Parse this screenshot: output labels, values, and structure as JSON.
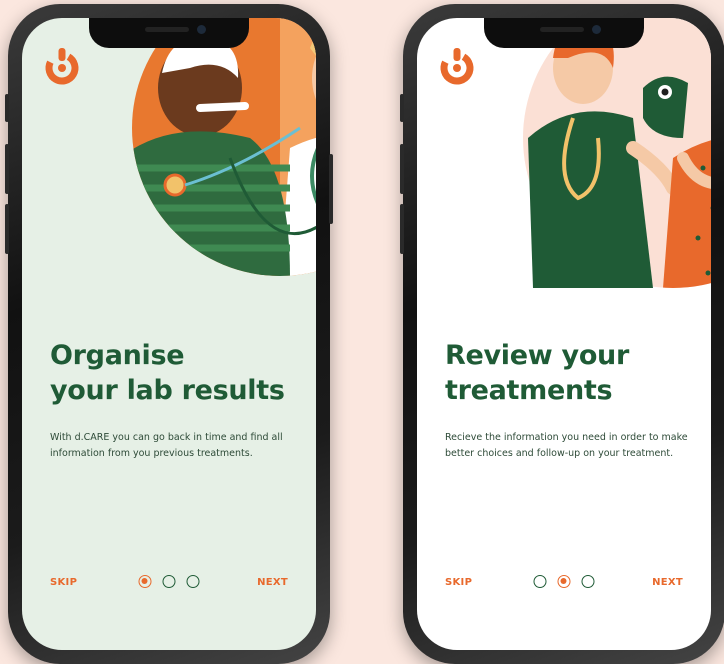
{
  "colors": {
    "brand_green": "#1f5b36",
    "accent_orange": "#e8692c",
    "page_background": "#fbe7df",
    "screen1_background": "#e6f0e6",
    "screen2_background": "#ffffff"
  },
  "screens": [
    {
      "logo_icon": "d-care-logo",
      "title_line1": "Organise",
      "title_line2": "your lab results",
      "description": "With d.CARE you can go back in time and find all information from you previous treatments.",
      "skip_label": "SKIP",
      "next_label": "NEXT",
      "page_indicator": {
        "current": 1,
        "total": 3
      }
    },
    {
      "logo_icon": "d-care-logo",
      "title_line1": "Review your",
      "title_line2": "treatments",
      "description": "Recieve the information you need in order to make better choices and follow-up on your treatment.",
      "skip_label": "SKIP",
      "next_label": "NEXT",
      "page_indicator": {
        "current": 2,
        "total": 3
      }
    }
  ]
}
